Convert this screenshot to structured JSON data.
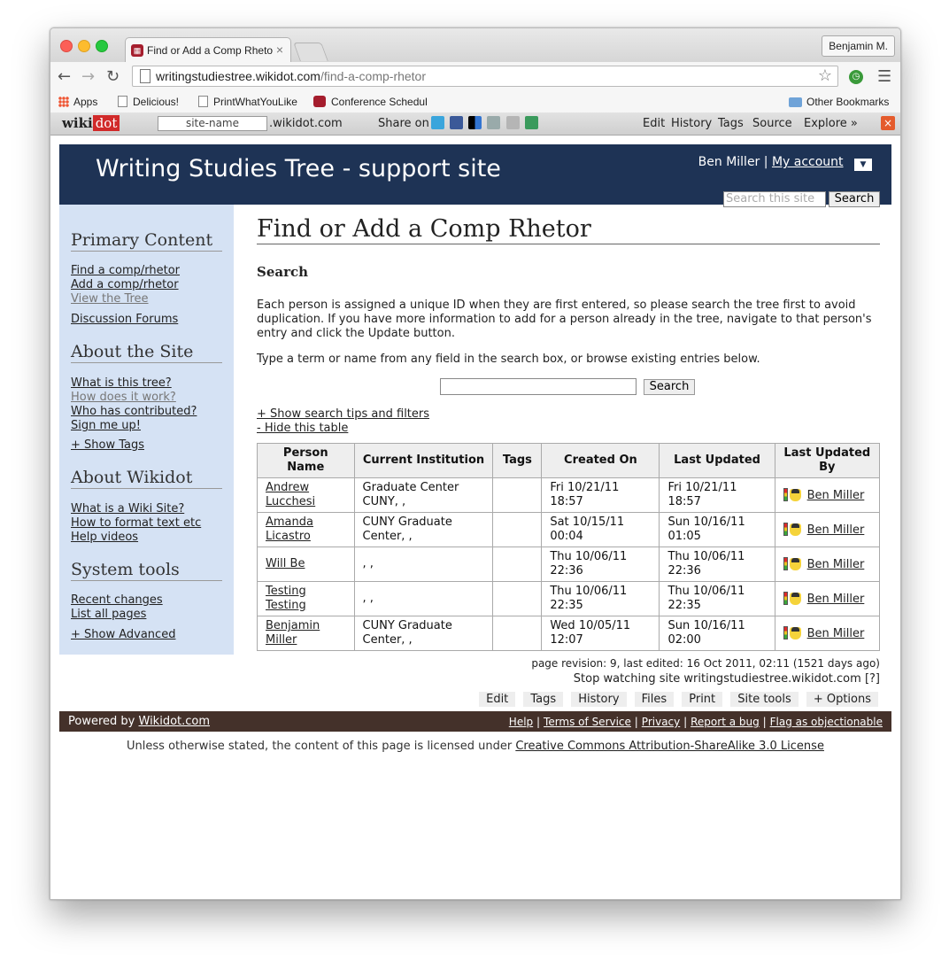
{
  "browser": {
    "tab_title": "Find or Add a Comp Rhetor",
    "tab_close": "×",
    "profile": "Benjamin M.",
    "url_host": "writingstudiestree.wikidot.com",
    "url_path": "/find-a-comp-rhetor",
    "bookmarks": [
      "Apps",
      "Delicious!",
      "PrintWhatYouLike",
      "Conference Schedul",
      "Other Bookmarks"
    ]
  },
  "wikidot_bar": {
    "logo_a": "wiki",
    "logo_b": "dot",
    "site_name_placeholder": "site-name",
    "domain": ".wikidot.com",
    "share_on": "Share on",
    "links": [
      "Edit",
      "History",
      "Tags",
      "Source",
      "Explore »"
    ],
    "close": "×"
  },
  "header": {
    "site_title": "Writing Studies Tree - support site",
    "user": "Ben Miller",
    "separator": "|",
    "my_account": "My account",
    "dropdown": "▼",
    "search_placeholder": "Search this site",
    "search_button": "Search"
  },
  "sidebar": {
    "primary_heading": "Primary Content",
    "primary_links": [
      "Find a comp/rhetor",
      "Add a comp/rhetor",
      "View the Tree",
      "Discussion Forums"
    ],
    "about_heading": "About the Site",
    "about_links": [
      "What is this tree?",
      "How does it work?",
      "Who has contributed?",
      "Sign me up!"
    ],
    "show_tags": "+ Show Tags",
    "wikidot_heading": "About Wikidot",
    "wikidot_links": [
      "What is a Wiki Site?",
      "How to format text etc",
      "Help videos"
    ],
    "tools_heading": "System tools",
    "tools_links": [
      "Recent changes",
      "List all pages"
    ],
    "show_advanced": "+ Show Advanced"
  },
  "main": {
    "page_title": "Find or Add a Comp Rhetor",
    "search_heading": "Search",
    "intro": "Each person is assigned a unique ID when they are first entered, so please search the tree first to avoid duplication. If you have more information to add for a person already in the tree, navigate to that person's entry and click the Update button.",
    "instruction": "Type a term or name from any field in the search box, or browse existing entries below.",
    "search_button": "Search",
    "show_tips": "+ Show search tips and filters",
    "hide_table": "- Hide this table",
    "table": {
      "headers": [
        "Person Name",
        "Current Institution",
        "Tags",
        "Created On",
        "Last Updated",
        "Last Updated By"
      ],
      "rows": [
        {
          "name": "Andrew Lucchesi",
          "institution": "Graduate Center CUNY, ,",
          "tags": "",
          "created": "Fri 10/21/11 18:57",
          "updated": "Fri 10/21/11 18:57",
          "by": "Ben Miller"
        },
        {
          "name": "Amanda Licastro",
          "institution": "CUNY Graduate Center, ,",
          "tags": "",
          "created": "Sat 10/15/11 00:04",
          "updated": "Sun 10/16/11 01:05",
          "by": "Ben Miller"
        },
        {
          "name": "Will Be",
          "institution": ", ,",
          "tags": "",
          "created": "Thu 10/06/11 22:36",
          "updated": "Thu 10/06/11 22:36",
          "by": "Ben Miller"
        },
        {
          "name": "Testing Testing",
          "institution": ", ,",
          "tags": "",
          "created": "Thu 10/06/11 22:35",
          "updated": "Thu 10/06/11 22:35",
          "by": "Ben Miller"
        },
        {
          "name": "Benjamin Miller",
          "institution": "CUNY Graduate Center, ,",
          "tags": "",
          "created": "Wed 10/05/11 12:07",
          "updated": "Sun 10/16/11 02:00",
          "by": "Ben Miller"
        }
      ]
    },
    "revision": "page revision: 9, last edited: 16 Oct 2011, 02:11 (1521 days ago)",
    "stop_watching": "Stop watching site writingstudiestree.wikidot.com",
    "help_mark": "[?]",
    "page_buttons": [
      "Edit",
      "Tags",
      "History",
      "Files",
      "Print",
      "Site tools",
      "+ Options"
    ]
  },
  "footer": {
    "powered_by": "Powered by",
    "powered_link": "Wikidot.com",
    "links": [
      "Help",
      "Terms of Service",
      "Privacy",
      "Report a bug",
      "Flag as objectionable"
    ],
    "sep": "|",
    "license_text": "Unless otherwise stated, the content of this page is licensed under",
    "license_link": "Creative Commons Attribution-ShareAlike 3.0 License"
  }
}
